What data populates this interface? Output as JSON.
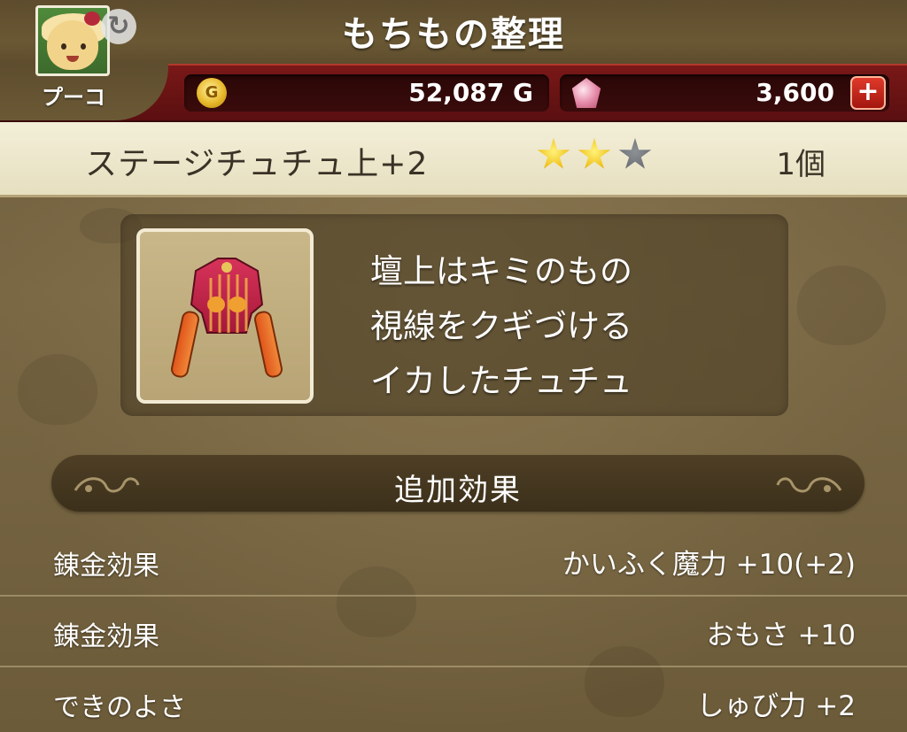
{
  "header": {
    "title": "もちもの整理",
    "character_name": "プーコ"
  },
  "currency": {
    "gold": {
      "icon": "gold-coin-icon",
      "symbol": "G",
      "value": "52,087 G"
    },
    "gems": {
      "icon": "gem-icon",
      "value": "3,600",
      "add_label": "+"
    }
  },
  "item": {
    "name": "ステージチュチュ上+2",
    "stars": {
      "filled": 2,
      "total": 3
    },
    "count": "1個",
    "icon": "tutu-top-icon",
    "description": [
      "壇上はキミのもの",
      "視線をクギづける",
      "イカしたチュチュ"
    ]
  },
  "effects": {
    "title": "追加効果",
    "rows": [
      {
        "label": "錬金効果",
        "value": "かいふく魔力 +10(+2)"
      },
      {
        "label": "錬金効果",
        "value": "おもさ +10"
      },
      {
        "label": "できのよさ",
        "value": "しゅび力 +2"
      }
    ]
  },
  "colors": {
    "currency_bar": "#6a1212",
    "name_bar": "#efe9cf",
    "star_on": "#f0c21c",
    "star_off": "#6f7378",
    "background": "#6e5d3b"
  }
}
